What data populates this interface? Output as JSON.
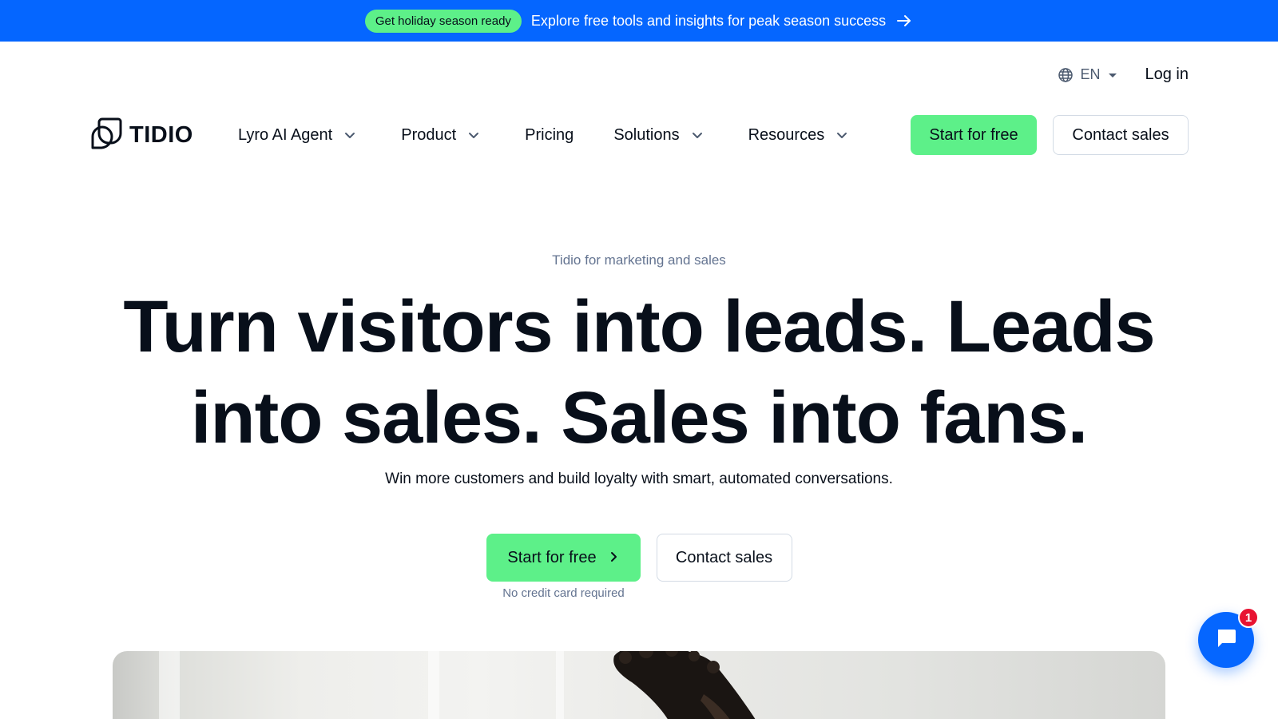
{
  "promo": {
    "pill": "Get holiday season ready",
    "text": "Explore free tools and insights for peak season success",
    "arrow_icon": "arrow-right-icon"
  },
  "utility": {
    "language": "EN",
    "language_icon": "globe-icon",
    "login": "Log in"
  },
  "nav": {
    "logo_text": "TIDIO",
    "items": [
      {
        "label": "Lyro AI Agent",
        "has_dropdown": true
      },
      {
        "label": "Product",
        "has_dropdown": true
      },
      {
        "label": "Pricing",
        "has_dropdown": false
      },
      {
        "label": "Solutions",
        "has_dropdown": true
      },
      {
        "label": "Resources",
        "has_dropdown": true
      }
    ],
    "start_button": "Start for free",
    "contact_button": "Contact sales"
  },
  "hero": {
    "eyebrow": "Tidio for marketing and sales",
    "headline": "Turn visitors into leads. Leads into sales. Sales into fans.",
    "subhead": "Win more customers and build loyalty with smart, automated conversations.",
    "primary_cta": "Start for free",
    "secondary_cta": "Contact sales",
    "note": "No credit card required"
  },
  "chat": {
    "icon": "chat-bubble-icon",
    "badge_count": "1"
  },
  "colors": {
    "brand_blue": "#0566ff",
    "accent_green": "#5df089",
    "text_dark": "#080f1a",
    "text_muted": "#647491",
    "badge_red": "#e81332"
  }
}
